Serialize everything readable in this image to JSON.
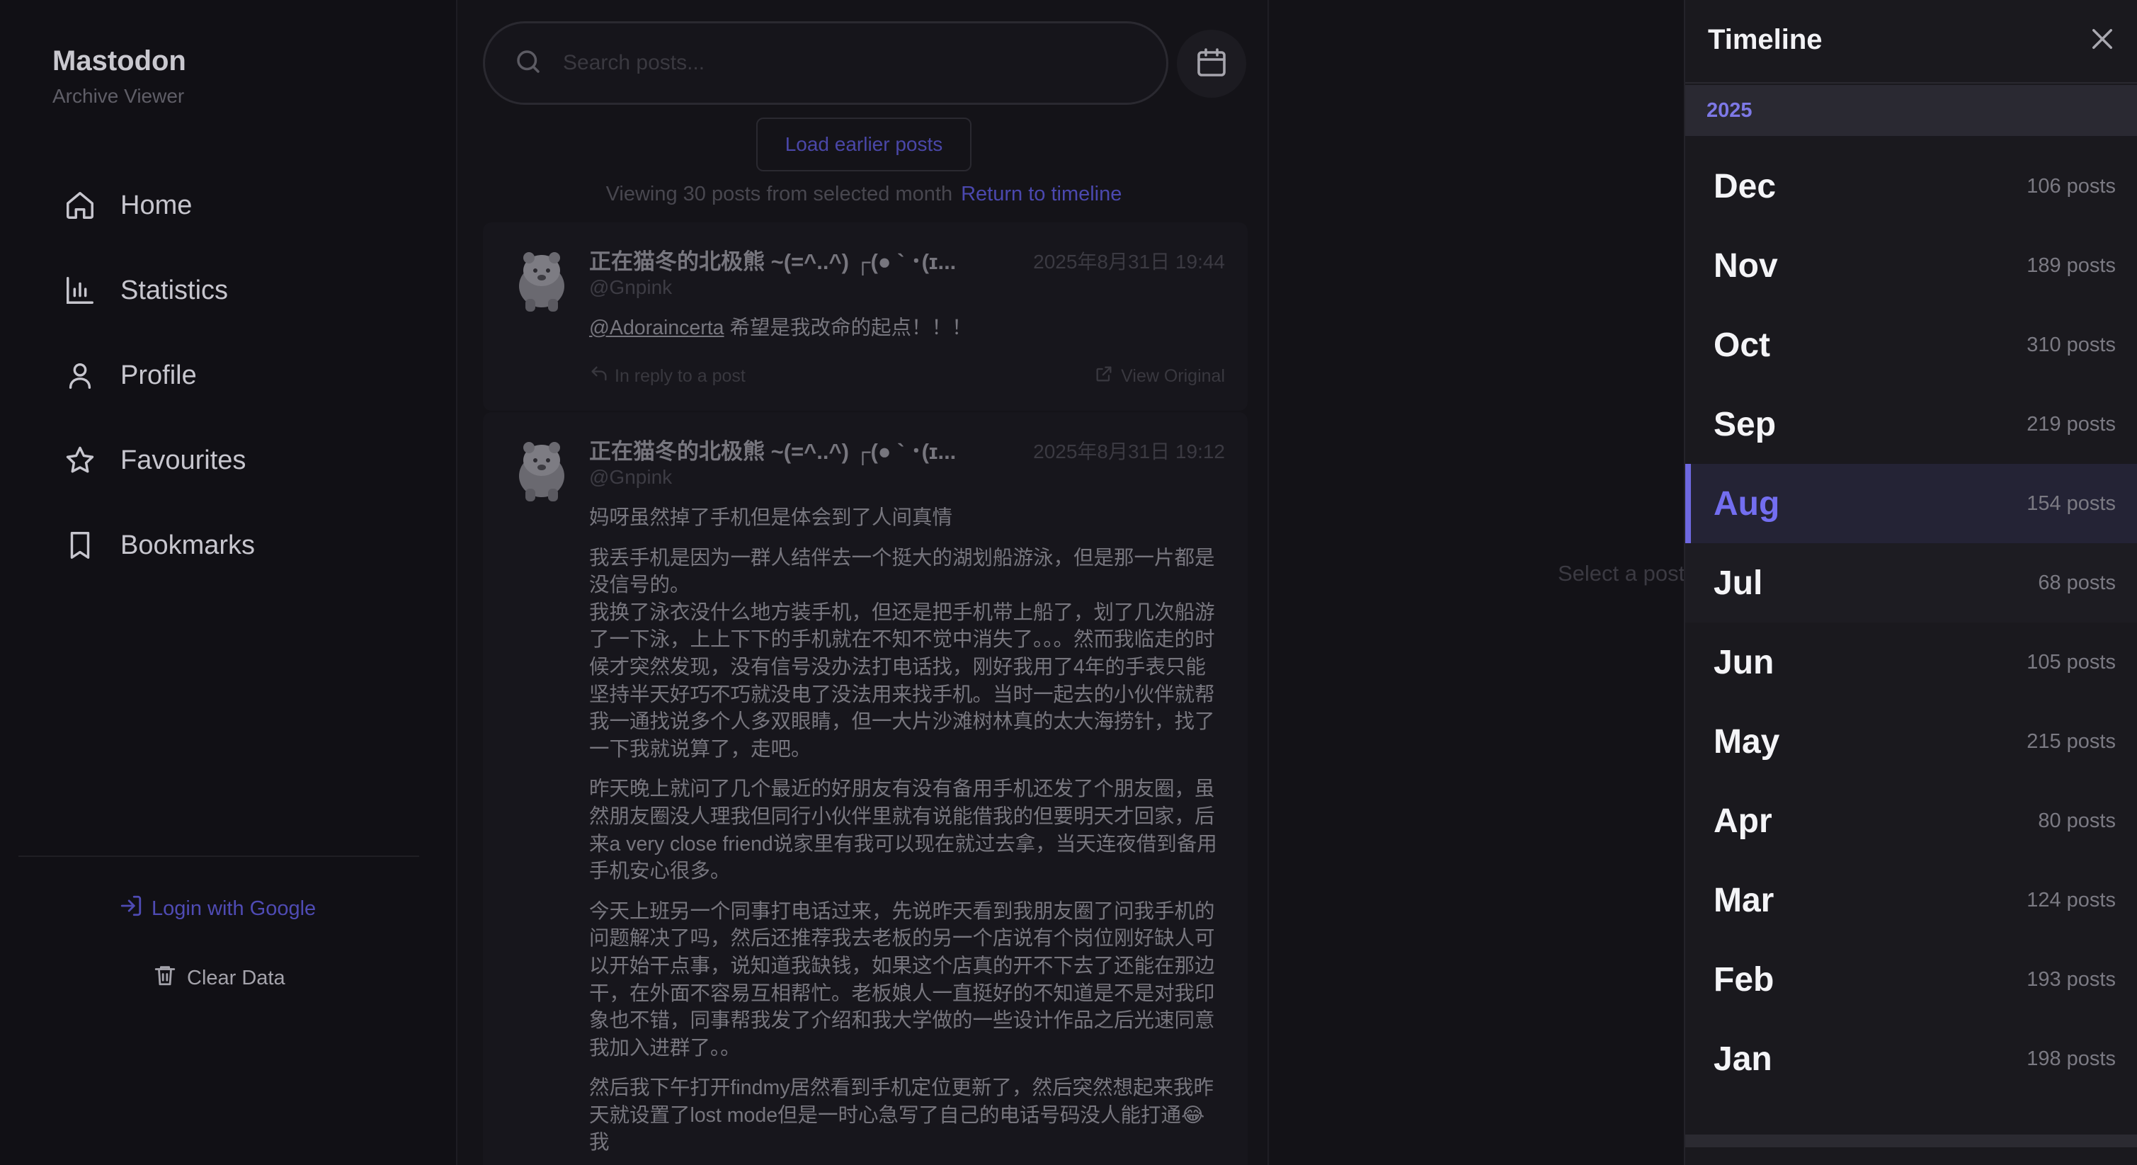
{
  "sidebar": {
    "brand_title": "Mastodon",
    "brand_subtitle": "Archive Viewer",
    "nav": [
      {
        "label": "Home",
        "icon": "home-icon"
      },
      {
        "label": "Statistics",
        "icon": "bar-chart-icon"
      },
      {
        "label": "Profile",
        "icon": "user-icon"
      },
      {
        "label": "Favourites",
        "icon": "star-icon"
      },
      {
        "label": "Bookmarks",
        "icon": "bookmark-icon"
      }
    ],
    "login_label": "Login with Google",
    "clear_label": "Clear Data"
  },
  "feed": {
    "search_placeholder": "Search posts...",
    "load_earlier_label": "Load earlier posts",
    "viewing_text": "Viewing 30 posts from selected month",
    "return_label": "Return to timeline",
    "posts": [
      {
        "display_name": "正在猫冬的北极熊 ~(=^..^) ┌(● ` ･(ɪ...",
        "handle": "@Gnpink",
        "timestamp": "2025年8月31日 19:44",
        "mention": "@Adoraincerta",
        "text": " 希望是我改命的起点！！！",
        "reply_label": "In reply to a post",
        "view_original_label": "View Original"
      },
      {
        "display_name": "正在猫冬的北极熊 ~(=^..^) ┌(● ` ･(ɪ...",
        "handle": "@Gnpink",
        "timestamp": "2025年8月31日 19:12",
        "paragraphs": [
          "妈呀虽然掉了手机但是体会到了人间真情",
          "我丢手机是因为一群人结伴去一个挺大的湖划船游泳，但是那一片都是没信号的。\n我换了泳衣没什么地方装手机，但还是把手机带上船了，划了几次船游了一下泳，上上下下的手机就在不知不觉中消失了。。。然而我临走的时候才突然发现，没有信号没办法打电话找，刚好我用了4年的手表只能坚持半天好巧不巧就没电了没法用来找手机。当时一起去的小伙伴就帮我一通找说多个人多双眼睛，但一大片沙滩树林真的太大海捞针，找了一下我就说算了，走吧。",
          "昨天晚上就问了几个最近的好朋友有没有备用手机还发了个朋友圈，虽然朋友圈没人理我但同行小伙伴里就有说能借我的但要明天才回家，后来a very close friend说家里有我可以现在就过去拿，当天连夜借到备用手机安心很多。",
          "今天上班另一个同事打电话过来，先说昨天看到我朋友圈了问我手机的问题解决了吗，然后还推荐我去老板的另一个店说有个岗位刚好缺人可以开始干点事，说知道我缺钱，如果这个店真的开不下去了还能在那边干，在外面不容易互相帮忙。老板娘人一直挺好的不知道是不是对我印象也不错，同事帮我发了介绍和我大学做的一些设计作品之后光速同意我加入进群了。。",
          "然后我下午打开findmy居然看到手机定位更新了，然后突然想起来我昨天就设置了lost mode但是一时心急写了自己的电话号码没人能打通😂 我"
        ]
      }
    ]
  },
  "detail": {
    "empty_text": "Select a post to view details"
  },
  "timeline": {
    "title": "Timeline",
    "year": "2025",
    "selected_month": "Aug",
    "months": [
      {
        "name": "Dec",
        "count": "106 posts"
      },
      {
        "name": "Nov",
        "count": "189 posts"
      },
      {
        "name": "Oct",
        "count": "310 posts"
      },
      {
        "name": "Sep",
        "count": "219 posts"
      },
      {
        "name": "Aug",
        "count": "154 posts"
      },
      {
        "name": "Jul",
        "count": "68 posts"
      },
      {
        "name": "Jun",
        "count": "105 posts"
      },
      {
        "name": "May",
        "count": "215 posts"
      },
      {
        "name": "Apr",
        "count": "80 posts"
      },
      {
        "name": "Mar",
        "count": "124 posts"
      },
      {
        "name": "Feb",
        "count": "193 posts"
      },
      {
        "name": "Jan",
        "count": "198 posts"
      }
    ]
  },
  "colors": {
    "accent": "#6e68e0",
    "background": "#141318",
    "panel": "#1a191e"
  }
}
